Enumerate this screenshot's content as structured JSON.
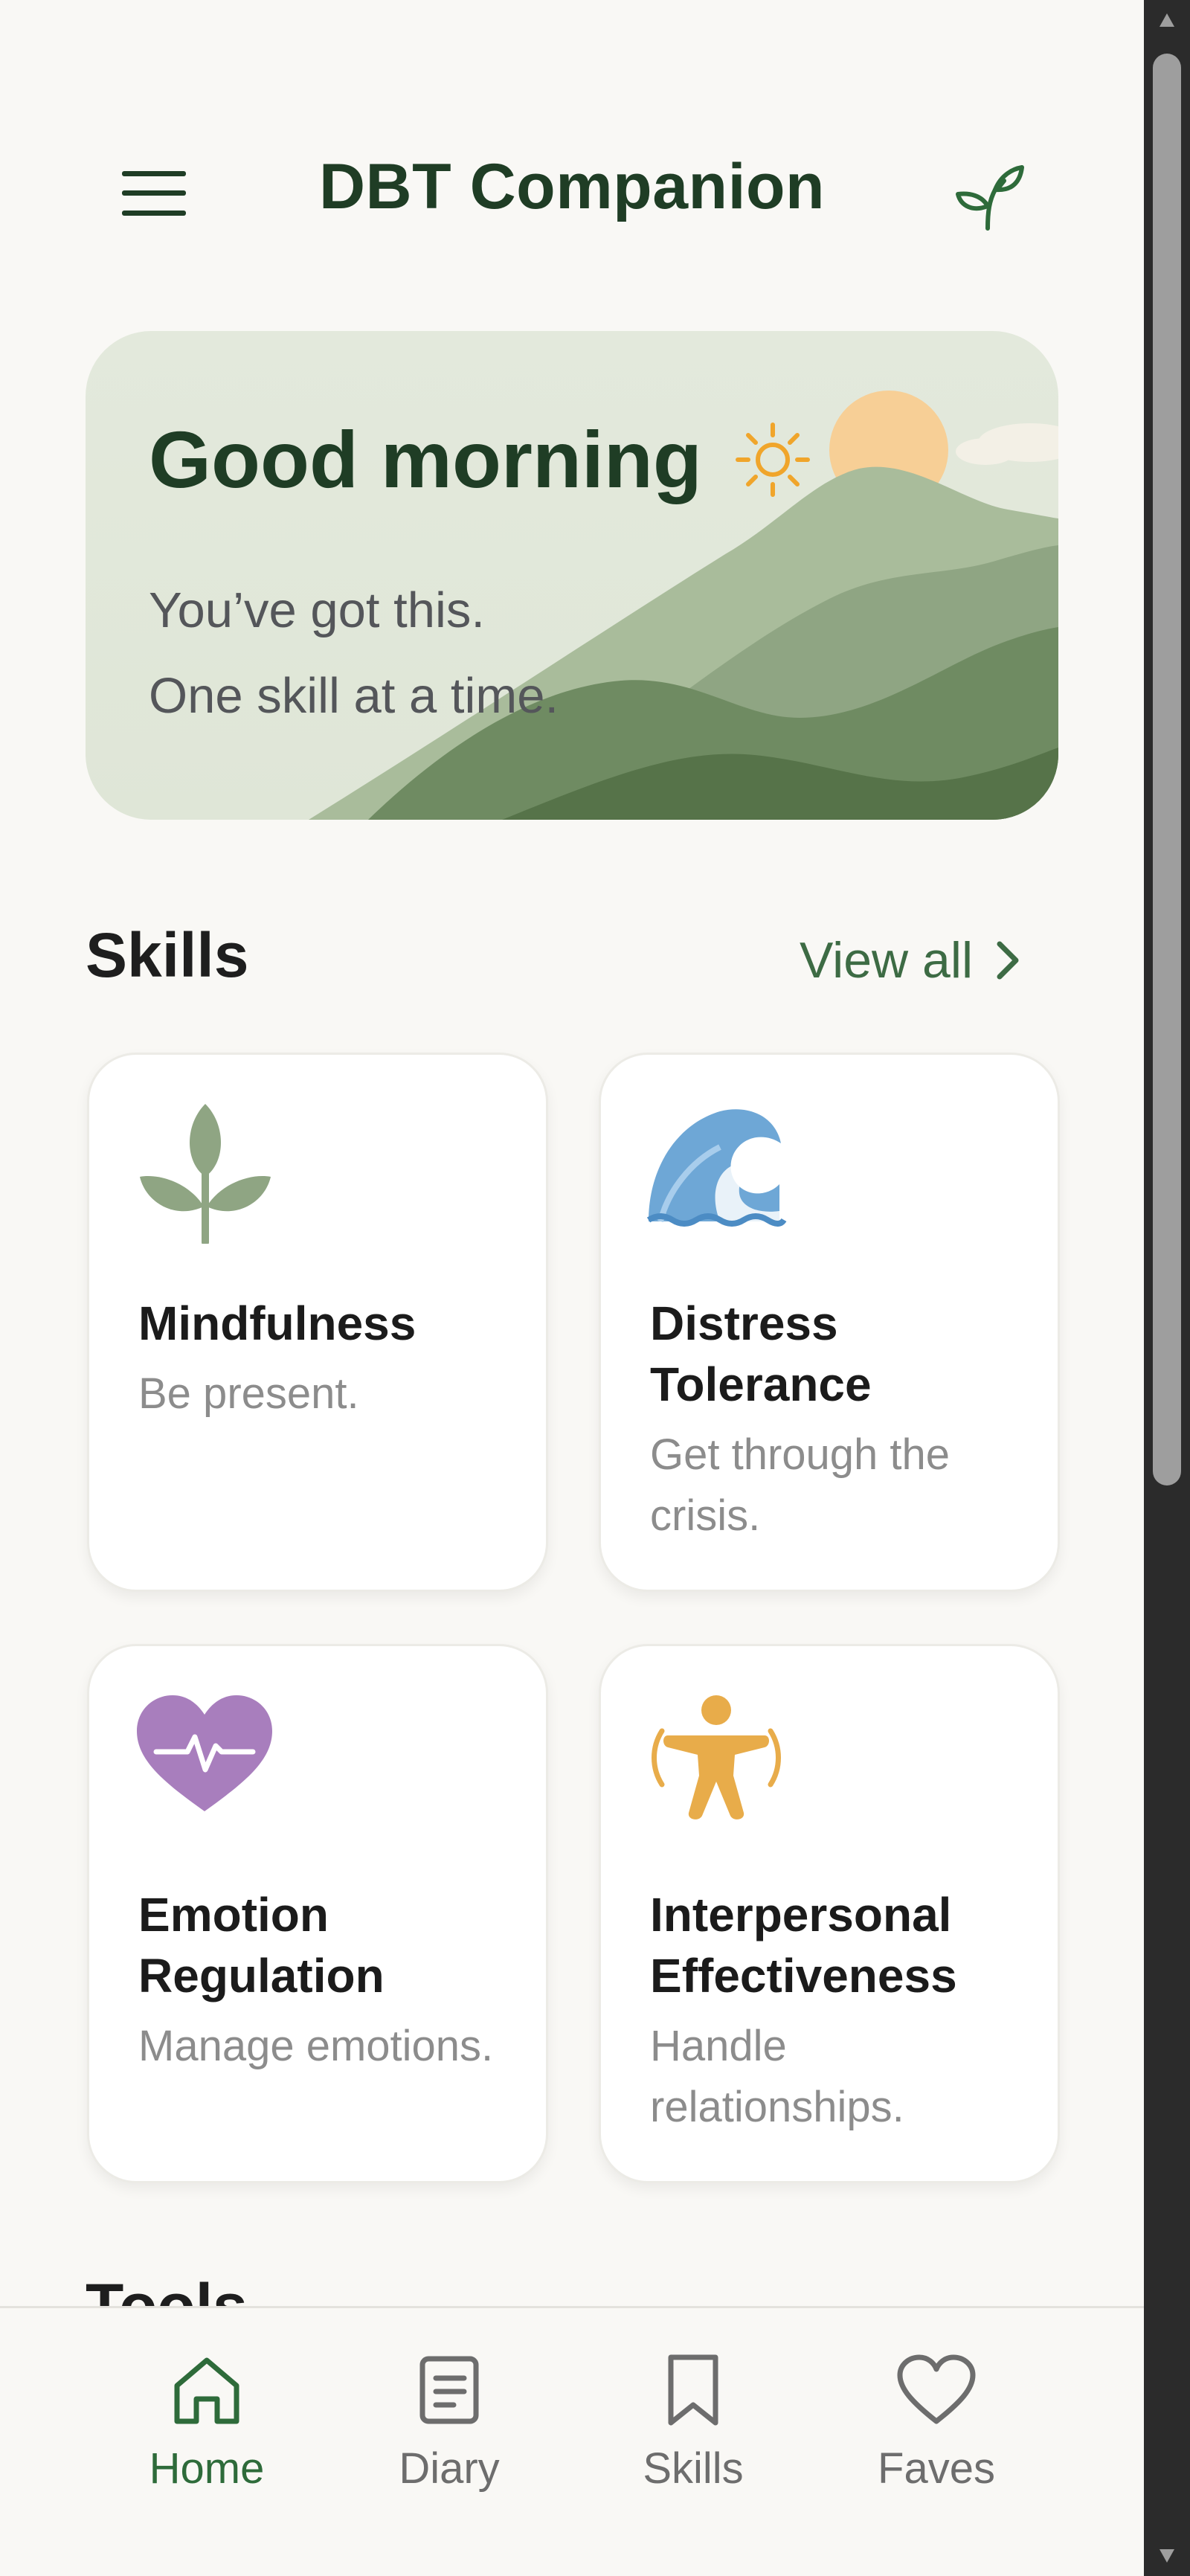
{
  "app": {
    "title": "DBT Companion",
    "menu_icon": "hamburger-menu-icon",
    "brand_icon": "sprout-leaf-icon"
  },
  "hero": {
    "greeting": "Good morning",
    "greeting_icon": "sun-icon",
    "line1": "You’ve got this.",
    "line2": "One skill at a time."
  },
  "skills_section": {
    "title": "Skills",
    "view_all_label": "View all",
    "cards": [
      {
        "icon": "sprout-icon",
        "name": "Mindfulness",
        "desc": "Be present.",
        "color": "#8fa583"
      },
      {
        "icon": "wave-icon",
        "name": "Distress Tolerance",
        "desc": "Get through the crisis.",
        "color": "#6ea7d6"
      },
      {
        "icon": "heart-pulse-icon",
        "name": "Emotion Regulation",
        "desc": "Manage emotions.",
        "color": "#a87ebd"
      },
      {
        "icon": "person-arms-out-icon",
        "name": "Interpersonal Effectiveness",
        "desc": "Handle relationships.",
        "color": "#e8ac4a"
      }
    ]
  },
  "next_section_peek": {
    "title": "Tools"
  },
  "bottom_nav": {
    "active": "Home",
    "items": [
      {
        "label": "Home",
        "icon": "home-icon"
      },
      {
        "label": "Diary",
        "icon": "diary-icon"
      },
      {
        "label": "Skills",
        "icon": "bookmark-icon"
      },
      {
        "label": "Faves",
        "icon": "heart-icon"
      }
    ]
  },
  "colors": {
    "background": "#f9f8f5",
    "primary_dark_green": "#1f3d25",
    "accent_green": "#3d6b44",
    "muted_text": "#8c8c8c"
  }
}
